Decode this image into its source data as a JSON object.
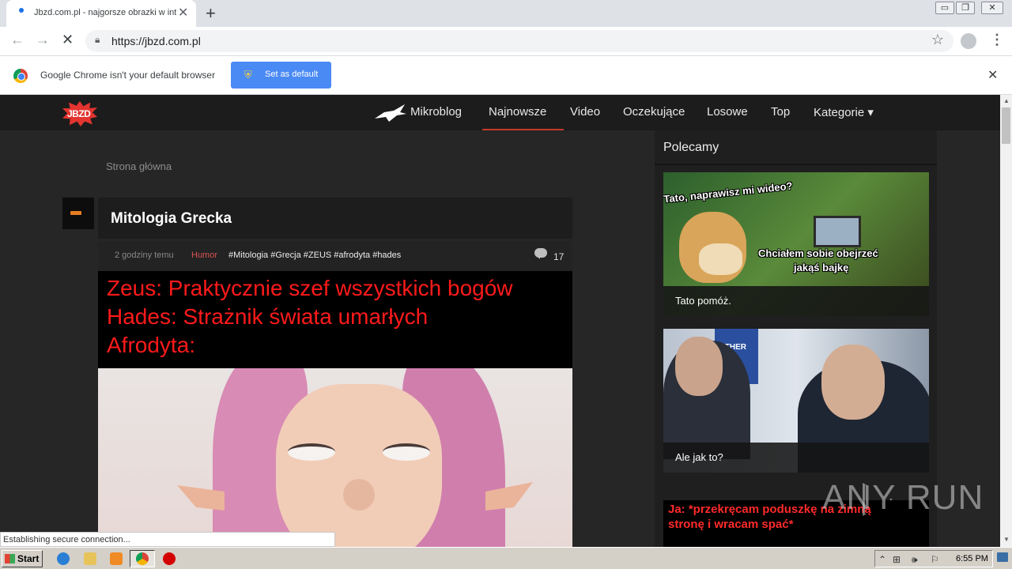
{
  "browser": {
    "tab_title": "Jbzd.com.pl - najgorsze obrazki w internecie",
    "new_tab": "+",
    "tab_close": "✕",
    "url": "https://jbzd.com.pl",
    "back_icon": "←",
    "forward_icon": "→",
    "reload_icon": "✕",
    "star_icon": "☆",
    "menu_icon": "⋮"
  },
  "infobar": {
    "text": "Google Chrome isn't your default browser",
    "button": "Set as default",
    "close": "✕"
  },
  "site": {
    "logo": "JBZD",
    "nav": {
      "mikroblog": "Mikroblog",
      "najnowsze": "Najnowsze",
      "video": "Video",
      "oczekujace": "Oczekujące",
      "losowe": "Losowe",
      "top": "Top",
      "kategorie": "Kategorie ▾"
    },
    "accent": "#c0392b"
  },
  "breadcrumb": "Strona główna",
  "post": {
    "title": "Mitologia Grecka",
    "time": "2 godziny temu",
    "category": "Humor",
    "tags": "#Mitologia #Grecja #ZEUS #afrodyta #hades",
    "comments": "17",
    "meme_lines": [
      "Zeus: Praktycznie szef wszystkich bogów",
      "Hades: Strażnik świata umarłych",
      "Afrodyta:"
    ]
  },
  "sidebar": {
    "title": "Polecamy",
    "items": [
      {
        "caption": "Tato pomóż.",
        "text_top": "Tato, naprawisz mi wideo?",
        "text_mid": "Chciałem sobie obejrzeć",
        "text_mid2": "jakąś bajkę"
      },
      {
        "caption": "Ale jak to?",
        "sign": "OTHER"
      },
      {
        "line1": "Ja: *przekręcam poduszkę na zimną",
        "line2": "stronę i wracam spać*"
      }
    ]
  },
  "watermark": "ANY   RUN",
  "status": "Establishing secure connection...",
  "taskbar": {
    "start": "Start",
    "clock": "6:55 PM"
  }
}
